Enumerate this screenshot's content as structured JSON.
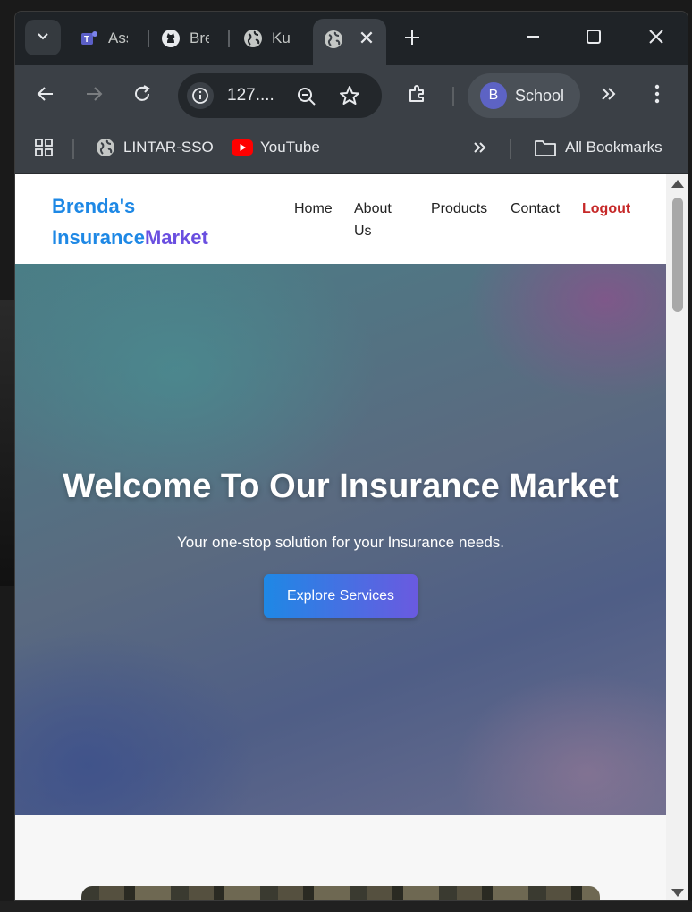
{
  "browser": {
    "tabs": [
      {
        "label": "Ass",
        "icon": "teams-icon"
      },
      {
        "label": "Bre",
        "icon": "github-icon"
      },
      {
        "label": "Ku",
        "icon": "globe-icon"
      },
      {
        "label": "",
        "icon": "globe-icon",
        "active": true
      }
    ],
    "url": "127....",
    "profile": {
      "initial": "B",
      "name": "School"
    },
    "bookmarks": [
      {
        "label": "LINTAR-SSO",
        "icon": "globe-icon"
      },
      {
        "label": "YouTube",
        "icon": "youtube-icon"
      }
    ],
    "all_bookmarks": "All Bookmarks"
  },
  "site": {
    "logo_line1": "Brenda's",
    "logo_insurance": "Insurance",
    "logo_market": "Market",
    "nav": {
      "home": "Home",
      "about_1": "About",
      "about_2": "Us",
      "products": "Products",
      "contact": "Contact",
      "logout": "Logout"
    },
    "hero": {
      "title": "Welcome To Our Insurance Market",
      "subtitle": "Your one-stop solution for your Insurance needs.",
      "button": "Explore Services"
    }
  },
  "colors": {
    "brand_blue": "#1e88e5",
    "brand_purple": "#6a4fe0",
    "logout_red": "#c62828"
  }
}
